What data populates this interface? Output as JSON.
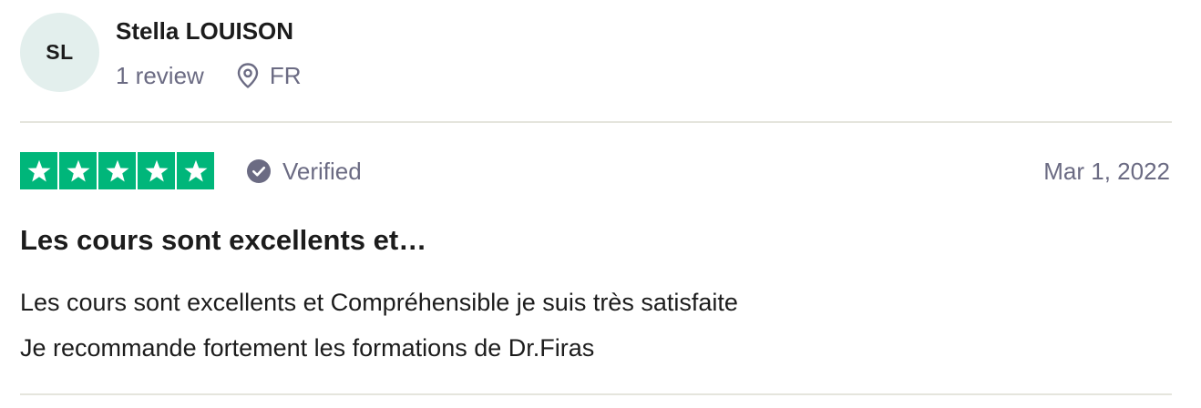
{
  "reviewer": {
    "initials": "SL",
    "name": "Stella LOUISON",
    "review_count": "1 review",
    "country": "FR",
    "avatar_bg": "#e3efed"
  },
  "rating": {
    "stars": 5,
    "max_stars": 5,
    "star_color": "#00b67a"
  },
  "verification": {
    "label": "Verified",
    "icon": "check-circle-icon"
  },
  "review": {
    "date": "Mar 1, 2022",
    "title": "Les cours sont excellents et…",
    "body_lines": [
      "Les cours sont excellents et Compréhensible je suis très satisfaite",
      "Je recommande fortement les formations de Dr.Firas"
    ]
  },
  "colors": {
    "muted_text": "#6b6b83",
    "main_text": "#1c1c1c",
    "divider": "#e5e5dd"
  }
}
